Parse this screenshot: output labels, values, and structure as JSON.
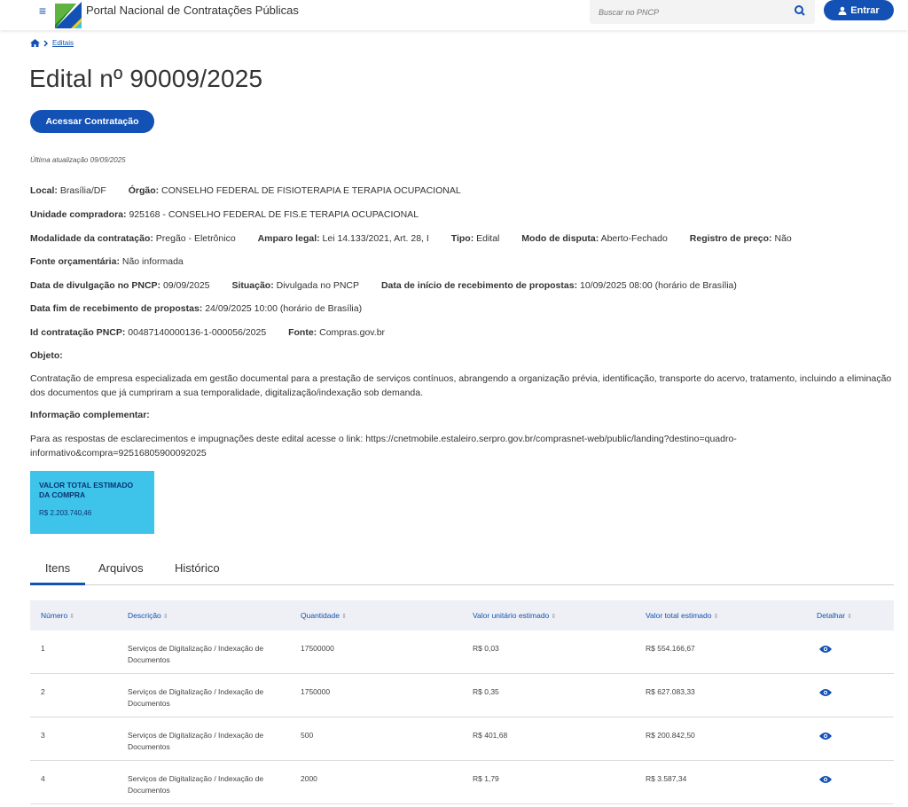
{
  "header": {
    "brand": "Portal Nacional de Contratações Públicas",
    "search_placeholder": "Buscar no PNCP",
    "login_label": "Entrar"
  },
  "breadcrumb": {
    "link": "Editais"
  },
  "title": "Edital nº 90009/2025",
  "access_button": "Acessar Contratação",
  "updated": "Última atualização 09/09/2025",
  "fields": {
    "local_label": "Local:",
    "local": "Brasília/DF",
    "orgao_label": "Órgão:",
    "orgao": "CONSELHO FEDERAL DE FISIOTERAPIA E TERAPIA OCUPACIONAL",
    "unidade_label": "Unidade compradora:",
    "unidade": "925168 - CONSELHO FEDERAL DE FIS.E TERAPIA OCUPACIONAL",
    "modalidade_label": "Modalidade da contratação:",
    "modalidade": "Pregão - Eletrônico",
    "amparo_label": "Amparo legal:",
    "amparo": "Lei 14.133/2021, Art. 28, I",
    "tipo_label": "Tipo:",
    "tipo": "Edital",
    "modo_label": "Modo de disputa:",
    "modo": "Aberto-Fechado",
    "registro_label": "Registro de preço:",
    "registro": "Não",
    "fonte_orc_label": "Fonte orçamentária:",
    "fonte_orc": "Não informada",
    "divulgacao_label": "Data de divulgação no PNCP:",
    "divulgacao": "09/09/2025",
    "situacao_label": "Situação:",
    "situacao": "Divulgada no PNCP",
    "inicio_label": "Data de início de recebimento de propostas:",
    "inicio": "10/09/2025 08:00 (horário de Brasília)",
    "fim_label": "Data fim de recebimento de propostas:",
    "fim": "24/09/2025 10:00 (horário de Brasília)",
    "id_label": "Id contratação PNCP:",
    "id": "00487140000136-1-000056/2025",
    "fonte_label": "Fonte:",
    "fonte": "Compras.gov.br",
    "objeto_label": "Objeto:",
    "objeto": "Contratação de empresa especializada em gestão documental para a prestação de serviços contínuos, abrangendo a organização prévia, identificação, transporte do acervo, tratamento, incluindo a eliminação dos documentos que já cumpriram a sua temporalidade, digitalização/indexação sob demanda.",
    "info_label": "Informação complementar:",
    "info": "Para as respostas de esclarecimentos e impugnações deste edital acesse o link: https://cnetmobile.estaleiro.serpro.gov.br/comprasnet-web/public/landing?destino=quadro-informativo&compra=92516805900092025"
  },
  "estimate": {
    "label": "VALOR TOTAL ESTIMADO DA COMPRA",
    "value": "R$ 2.203.740,46"
  },
  "tabs": [
    "Itens",
    "Arquivos",
    "Histórico"
  ],
  "table": {
    "headers": [
      "Número",
      "Descrição",
      "Quantidade",
      "Valor unitário estimado",
      "Valor total estimado",
      "Detalhar"
    ],
    "rows": [
      {
        "numero": "1",
        "descricao": "Serviços de Digitalização / Indexação de Documentos",
        "quantidade": "17500000",
        "unitario": "R$ 0,03",
        "total": "R$ 554.166,67"
      },
      {
        "numero": "2",
        "descricao": "Serviços de Digitalização / Indexação de Documentos",
        "quantidade": "1750000",
        "unitario": "R$ 0,35",
        "total": "R$ 627.083,33"
      },
      {
        "numero": "3",
        "descricao": "Serviços de Digitalização / Indexação de Documentos",
        "quantidade": "500",
        "unitario": "R$ 401,68",
        "total": "R$ 200.842,50"
      },
      {
        "numero": "4",
        "descricao": "Serviços de Digitalização / Indexação de Documentos",
        "quantidade": "2000",
        "unitario": "R$ 1,79",
        "total": "R$ 3.587,34"
      }
    ]
  },
  "colors": {
    "primary": "#1351b4",
    "estimate_bg": "#3ec4eb",
    "estimate_text": "#0c326f"
  }
}
